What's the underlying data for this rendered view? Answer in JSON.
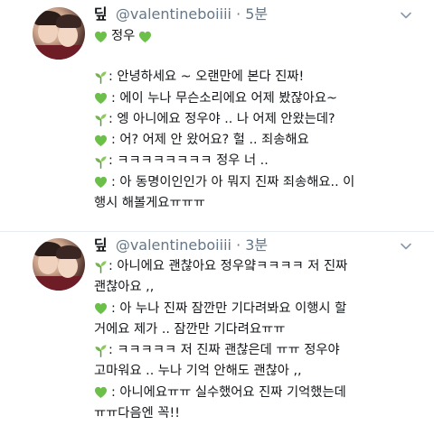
{
  "tweets": [
    {
      "name": "딮",
      "handle": "@valentineboiiii",
      "separator": "·",
      "time": "5분",
      "title_line": "정우",
      "lines": [
        {
          "icon": "sprout-icon",
          "text": ": 안녕하세요 ~ 오랜만에 본다 진짜!"
        },
        {
          "icon": "green-heart-icon",
          "text": ": 에이 누나 무슨소리에요 어제 봤잖아요~"
        },
        {
          "icon": "sprout-icon",
          "text": ": 엥 아니에요 정우야 .. 나 어제 안왔는데?"
        },
        {
          "icon": "green-heart-icon",
          "text": ": 어? 어제 안 왔어요? 헐 .. 죄송해요"
        },
        {
          "icon": "sprout-icon",
          "text": ": ㅋㅋㅋㅋㅋㅋㅋㅋ 정우 너 .."
        },
        {
          "icon": "green-heart-icon",
          "text": ": 아 동명이인인가 아 뭐지 진짜 죄송해요.. 이"
        },
        {
          "icon": "",
          "text": "행시 해볼게요ㅠㅠㅠ"
        }
      ]
    },
    {
      "name": "딮",
      "handle": "@valentineboiiii",
      "separator": "·",
      "time": "3분",
      "lines": [
        {
          "icon": "sprout-icon",
          "text": ": 아니에요 괜찮아요 정우얔ㅋㅋㅋㅋ 저 진짜"
        },
        {
          "icon": "",
          "text": "괜찮아요 ,,"
        },
        {
          "icon": "green-heart-icon",
          "text": ": 아 누나 진짜 잠깐만 기다려봐요 이행시 할"
        },
        {
          "icon": "",
          "text": "거에요 제가 .. 잠깐만 기다려요ㅠㅠ"
        },
        {
          "icon": "sprout-icon",
          "text": ": ㅋㅋㅋㅋㅋ 저 진짜 괜찮은데 ㅠㅠ 정우야"
        },
        {
          "icon": "",
          "text": "고마워요 .. 누나 기억 안해도 괜찮아 ,,"
        },
        {
          "icon": "green-heart-icon",
          "text": ": 아니에요ㅠㅠ 실수했어요 진짜 기억했는데"
        },
        {
          "icon": "",
          "text": "ㅠㅠ다음엔 꼭!!"
        }
      ]
    }
  ],
  "colors": {
    "heart": "#6cc04a",
    "sprout": "#77b255",
    "muted": "#657786"
  }
}
